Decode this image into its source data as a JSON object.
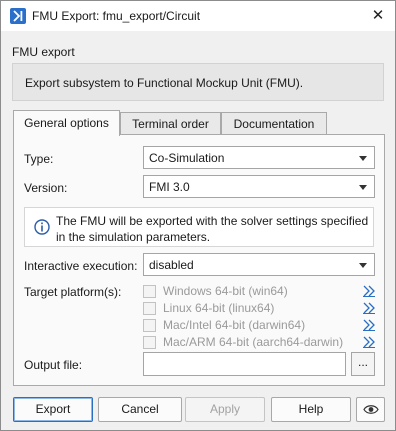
{
  "window": {
    "title": "FMU Export: fmu_export/Circuit",
    "close_label": "✕"
  },
  "section": {
    "label": "FMU export",
    "description": "Export subsystem to Functional Mockup Unit (FMU)."
  },
  "tabs": [
    {
      "label": "General options"
    },
    {
      "label": "Terminal order"
    },
    {
      "label": "Documentation"
    }
  ],
  "general": {
    "type_label": "Type:",
    "type_value": "Co-Simulation",
    "version_label": "Version:",
    "version_value": "FMI 3.0",
    "info_text": "The FMU will be exported with the solver settings specified in the simulation parameters.",
    "interactive_label": "Interactive execution:",
    "interactive_value": "disabled",
    "platform_label": "Target platform(s):",
    "platforms": [
      {
        "label": "Windows 64-bit (win64)",
        "checked": false,
        "enabled": false
      },
      {
        "label": "Linux 64-bit (linux64)",
        "checked": false,
        "enabled": false
      },
      {
        "label": "Mac/Intel 64-bit (darwin64)",
        "checked": false,
        "enabled": false
      },
      {
        "label": "Mac/ARM 64-bit (aarch64-darwin)",
        "checked": false,
        "enabled": false
      }
    ],
    "output_label": "Output file:",
    "output_value": "",
    "browse_label": "..."
  },
  "buttons": {
    "export": "Export",
    "cancel": "Cancel",
    "apply": "Apply",
    "help": "Help"
  },
  "icons": {
    "app": "simulation-app-icon",
    "info": "info-icon",
    "platform_link": "double-chevron-right-icon",
    "eye": "eye-icon"
  },
  "colors": {
    "accent": "#2b6fc2",
    "link": "#2b6fc2"
  }
}
